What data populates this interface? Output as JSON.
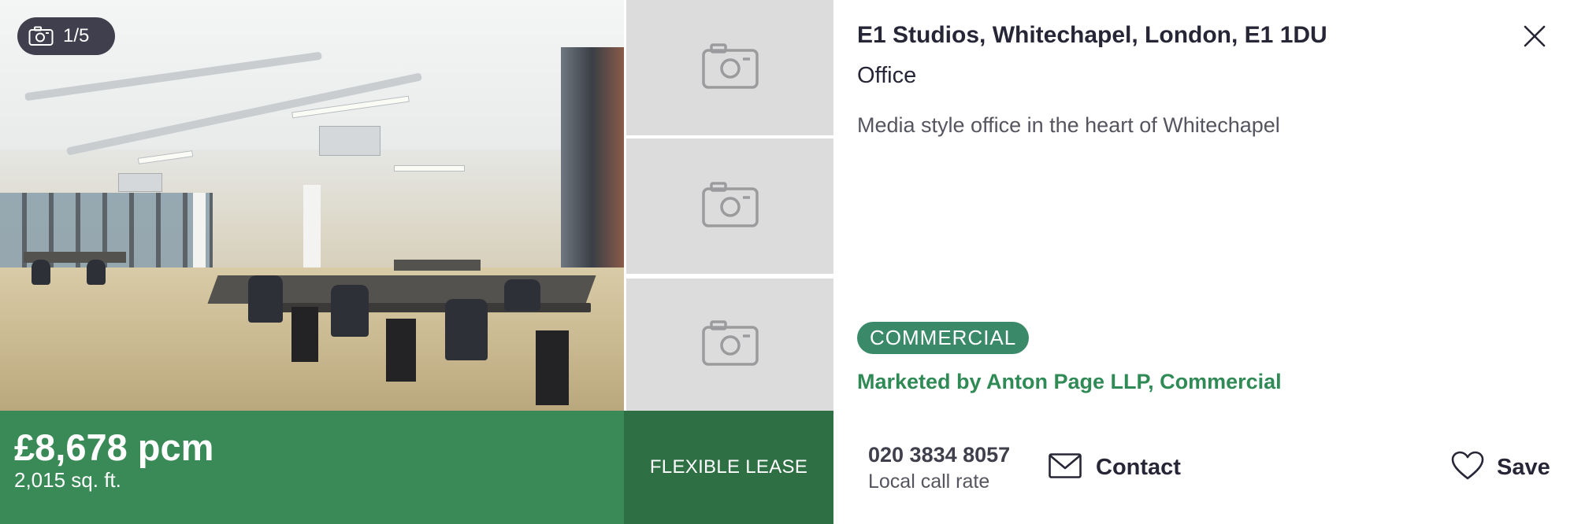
{
  "gallery": {
    "counter_text": "1/5",
    "main_photo_alt": "camera-icon",
    "thumbnails": [
      {
        "icon": "camera-icon"
      },
      {
        "icon": "camera-icon"
      },
      {
        "icon": "camera-icon"
      }
    ]
  },
  "price": {
    "amount": "£8,678 pcm",
    "size": "2,015 sq. ft.",
    "lease_label": "FLEXIBLE LEASE"
  },
  "listing": {
    "address": "E1 Studios, Whitechapel, London, E1 1DU",
    "property_type": "Office",
    "summary": "Media style office in the heart of Whitechapel",
    "badge": "COMMERCIAL",
    "marketed_by": "Marketed by Anton Page LLP, Commercial"
  },
  "actions": {
    "phone": "020 3834 8057",
    "call_rate": "Local call rate",
    "contact_label": "Contact",
    "save_label": "Save",
    "close_icon": "close-icon",
    "mail_icon": "mail-icon",
    "heart_icon": "heart-icon"
  },
  "colors": {
    "price_bar": "#3a8a57",
    "lease_bar": "#2e6f43",
    "badge": "#3a8a6a",
    "agent_link": "#2f8a55",
    "thumb_bg": "#dcdcdd"
  }
}
